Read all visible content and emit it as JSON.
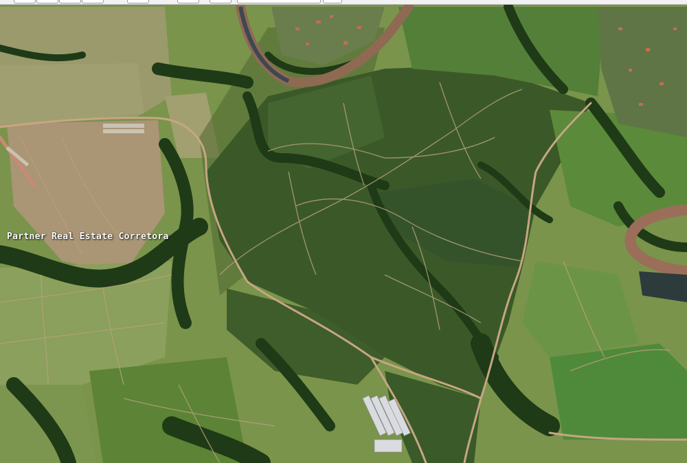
{
  "map": {
    "type": "satellite-aerial-view",
    "watermark_text": "Partner Real Estate Corretora"
  },
  "toolbar": {
    "buttons": [
      "",
      "",
      "",
      "",
      "",
      "",
      "",
      "",
      ""
    ]
  },
  "colors": {
    "pasture": "#7e9a4e",
    "crop_field": "#3f5e2b",
    "forest": "#1f3a17",
    "dirt_road": "#c9a883",
    "river": "#a0705a",
    "water": "#2d3b3c"
  }
}
